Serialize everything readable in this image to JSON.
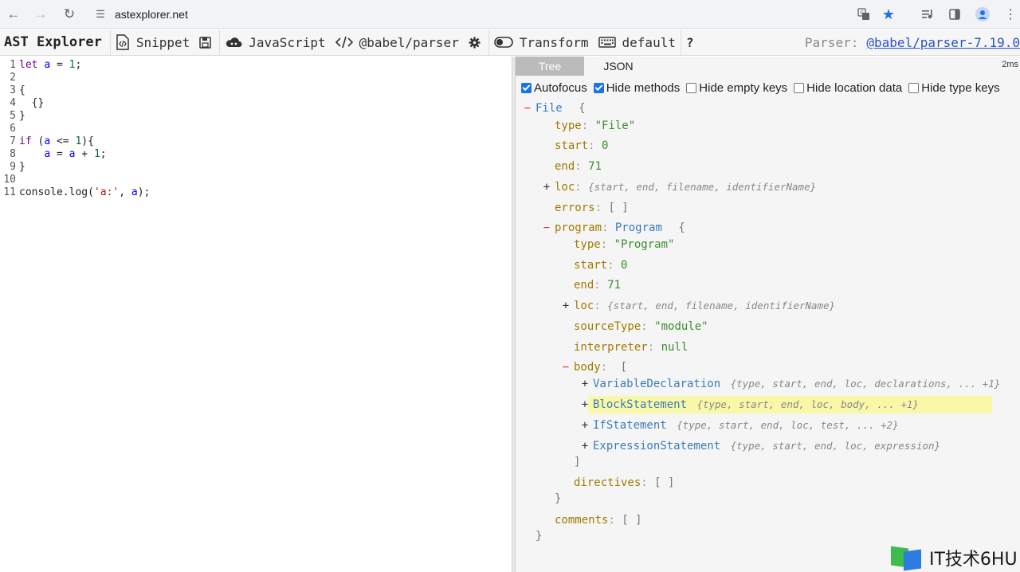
{
  "browser": {
    "url": "astexplorer.net"
  },
  "toolbar": {
    "brand": "AST Explorer",
    "snippet_label": "Snippet",
    "language_label": "JavaScript",
    "parser_label": "@babel/parser",
    "transform_label": "Transform",
    "keymap_label": "default",
    "help_label": "?",
    "parser_prefix": "Parser:",
    "parser_version": "@babel/parser-7.19.0"
  },
  "editor": {
    "lines": [
      {
        "n": "1",
        "text": "let a = 1;"
      },
      {
        "n": "2",
        "text": ""
      },
      {
        "n": "3",
        "text": "{"
      },
      {
        "n": "4",
        "text": "  {}"
      },
      {
        "n": "5",
        "text": "}"
      },
      {
        "n": "6",
        "text": ""
      },
      {
        "n": "7",
        "text": "if (a <= 1){"
      },
      {
        "n": "8",
        "text": "    a = a + 1;"
      },
      {
        "n": "9",
        "text": "}"
      },
      {
        "n": "10",
        "text": ""
      },
      {
        "n": "11",
        "text": "console.log('a:', a);"
      }
    ]
  },
  "output": {
    "tabs": [
      {
        "label": "Tree",
        "active": true
      },
      {
        "label": "JSON",
        "active": false
      }
    ],
    "timing": "2ms",
    "options": [
      {
        "label": "Autofocus",
        "checked": true
      },
      {
        "label": "Hide methods",
        "checked": true
      },
      {
        "label": "Hide empty keys",
        "checked": false
      },
      {
        "label": "Hide location data",
        "checked": false
      },
      {
        "label": "Hide type keys",
        "checked": false
      }
    ],
    "tree": {
      "file_label": "File",
      "open_brace": "{",
      "close_brace": "}",
      "open_bracket": "[",
      "close_bracket": "]",
      "empty_array": "[ ]",
      "file_type_key": "type",
      "file_type_value": "\"File\"",
      "start_key": "start",
      "start_value": "0",
      "end_key": "end",
      "end_value": "71",
      "loc_key": "loc",
      "loc_summary": "{start, end, filename, identifierName}",
      "errors_key": "errors",
      "program_key": "program",
      "program_type": "Program",
      "program_type_value": "\"Program\"",
      "source_type_key": "sourceType",
      "source_type_value": "\"module\"",
      "interpreter_key": "interpreter",
      "interpreter_value": "null",
      "body_key": "body",
      "directives_key": "directives",
      "comments_key": "comments",
      "body_items": [
        {
          "name": "VariableDeclaration",
          "summary": "{type, start, end, loc, declarations, ... +1}"
        },
        {
          "name": "BlockStatement",
          "summary": "{type, start, end, loc, body, ... +1}"
        },
        {
          "name": "IfStatement",
          "summary": "{type, start, end, loc, test, ... +2}"
        },
        {
          "name": "ExpressionStatement",
          "summary": "{type, start, end, loc, expression}"
        }
      ],
      "minus": "−",
      "plus": "+"
    }
  },
  "watermark": {
    "text": "IT技术6HU"
  },
  "colors": {
    "accent": "#1a73e8",
    "highlight": "#f9f7a8",
    "key": "#a07b00",
    "type": "#3a7cb8"
  }
}
